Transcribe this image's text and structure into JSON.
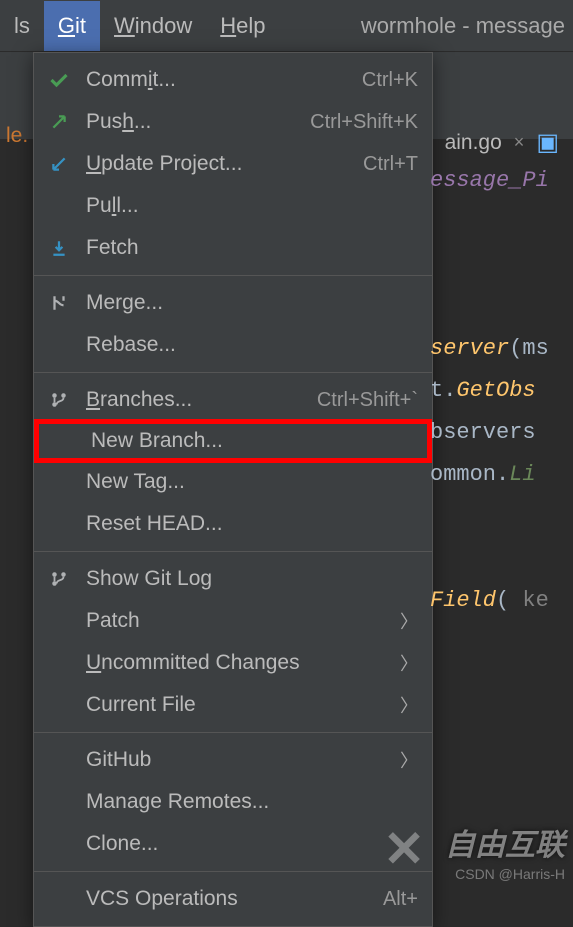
{
  "menubar": {
    "items": [
      {
        "pre": "",
        "u": "",
        "post": "ls"
      },
      {
        "pre": "",
        "u": "G",
        "post": "it"
      },
      {
        "pre": "",
        "u": "W",
        "post": "indow"
      },
      {
        "pre": "",
        "u": "H",
        "post": "elp"
      }
    ],
    "title": "wormhole - message"
  },
  "breadcrumb": "le.",
  "file_tab": {
    "name": "ain.go",
    "close": "×"
  },
  "dropdown": {
    "sections": [
      [
        {
          "icon": "check",
          "pre": "Comm",
          "u": "i",
          "post": "t...",
          "shortcut": "Ctrl+K"
        },
        {
          "icon": "arrow-up",
          "pre": "Pus",
          "u": "h",
          "post": "...",
          "shortcut": "Ctrl+Shift+K"
        },
        {
          "icon": "arrow-down",
          "pre": "",
          "u": "U",
          "post": "pdate Project...",
          "shortcut": "Ctrl+T"
        },
        {
          "icon": "",
          "pre": "Pu",
          "u": "l",
          "post": "l...",
          "shortcut": ""
        },
        {
          "icon": "fetch",
          "pre": "Fetch",
          "u": "",
          "post": "",
          "shortcut": ""
        }
      ],
      [
        {
          "icon": "merge",
          "pre": "Merge...",
          "u": "",
          "post": "",
          "shortcut": ""
        },
        {
          "icon": "",
          "pre": "Rebase...",
          "u": "",
          "post": "",
          "shortcut": ""
        }
      ],
      [
        {
          "icon": "branch",
          "pre": "",
          "u": "B",
          "post": "ranches...",
          "shortcut": "Ctrl+Shift+`"
        },
        {
          "icon": "",
          "pre": "New Branch...",
          "u": "",
          "post": "",
          "shortcut": "",
          "highlight": true
        },
        {
          "icon": "",
          "pre": "New Tag...",
          "u": "",
          "post": "",
          "shortcut": ""
        },
        {
          "icon": "",
          "pre": "Reset HEAD...",
          "u": "",
          "post": "",
          "shortcut": ""
        }
      ],
      [
        {
          "icon": "branch",
          "pre": "Show Git Log",
          "u": "",
          "post": "",
          "shortcut": ""
        },
        {
          "icon": "",
          "pre": "Patch",
          "u": "",
          "post": "",
          "submenu": true
        },
        {
          "icon": "",
          "pre": "",
          "u": "U",
          "post": "ncommitted Changes",
          "submenu": true
        },
        {
          "icon": "",
          "pre": "Current File",
          "u": "",
          "post": "",
          "submenu": true
        }
      ],
      [
        {
          "icon": "",
          "pre": "GitHub",
          "u": "",
          "post": "",
          "submenu": true
        },
        {
          "icon": "",
          "pre": "Manage Remotes...",
          "u": "",
          "post": "",
          "shortcut": ""
        },
        {
          "icon": "",
          "pre": "Clone...",
          "u": "",
          "post": "",
          "shortcut": ""
        }
      ],
      [
        {
          "icon": "",
          "pre": "VCS Operations",
          "u": "",
          "post": "",
          "shortcut": "Alt+"
        }
      ]
    ]
  },
  "code": {
    "lines": [
      {
        "parts": [
          {
            "t": "essage_Pi",
            "c": "kw-purple"
          }
        ]
      },
      {
        "parts": []
      },
      {
        "parts": []
      },
      {
        "parts": []
      },
      {
        "parts": [
          {
            "t": "server",
            "c": "kw-yellow"
          },
          {
            "t": "(ms",
            "c": ""
          }
        ]
      },
      {
        "parts": [
          {
            "t": "t.",
            "c": ""
          },
          {
            "t": "GetObs",
            "c": "kw-yellow"
          }
        ]
      },
      {
        "parts": [
          {
            "t": "bservers",
            "c": ""
          }
        ]
      },
      {
        "parts": [
          {
            "t": "ommon.",
            "c": ""
          },
          {
            "t": "Li",
            "c": "kw-green"
          }
        ]
      },
      {
        "parts": []
      },
      {
        "parts": []
      },
      {
        "parts": [
          {
            "t": "Field",
            "c": "kw-yellow"
          },
          {
            "t": "( ",
            "c": ""
          },
          {
            "t": "ke",
            "c": "kw-gray"
          }
        ]
      }
    ]
  },
  "watermark": {
    "brand": "自由互联",
    "credit": "CSDN @Harris-H"
  },
  "colors": {
    "accent": "#4b6eaf",
    "highlight": "#ff0000"
  }
}
